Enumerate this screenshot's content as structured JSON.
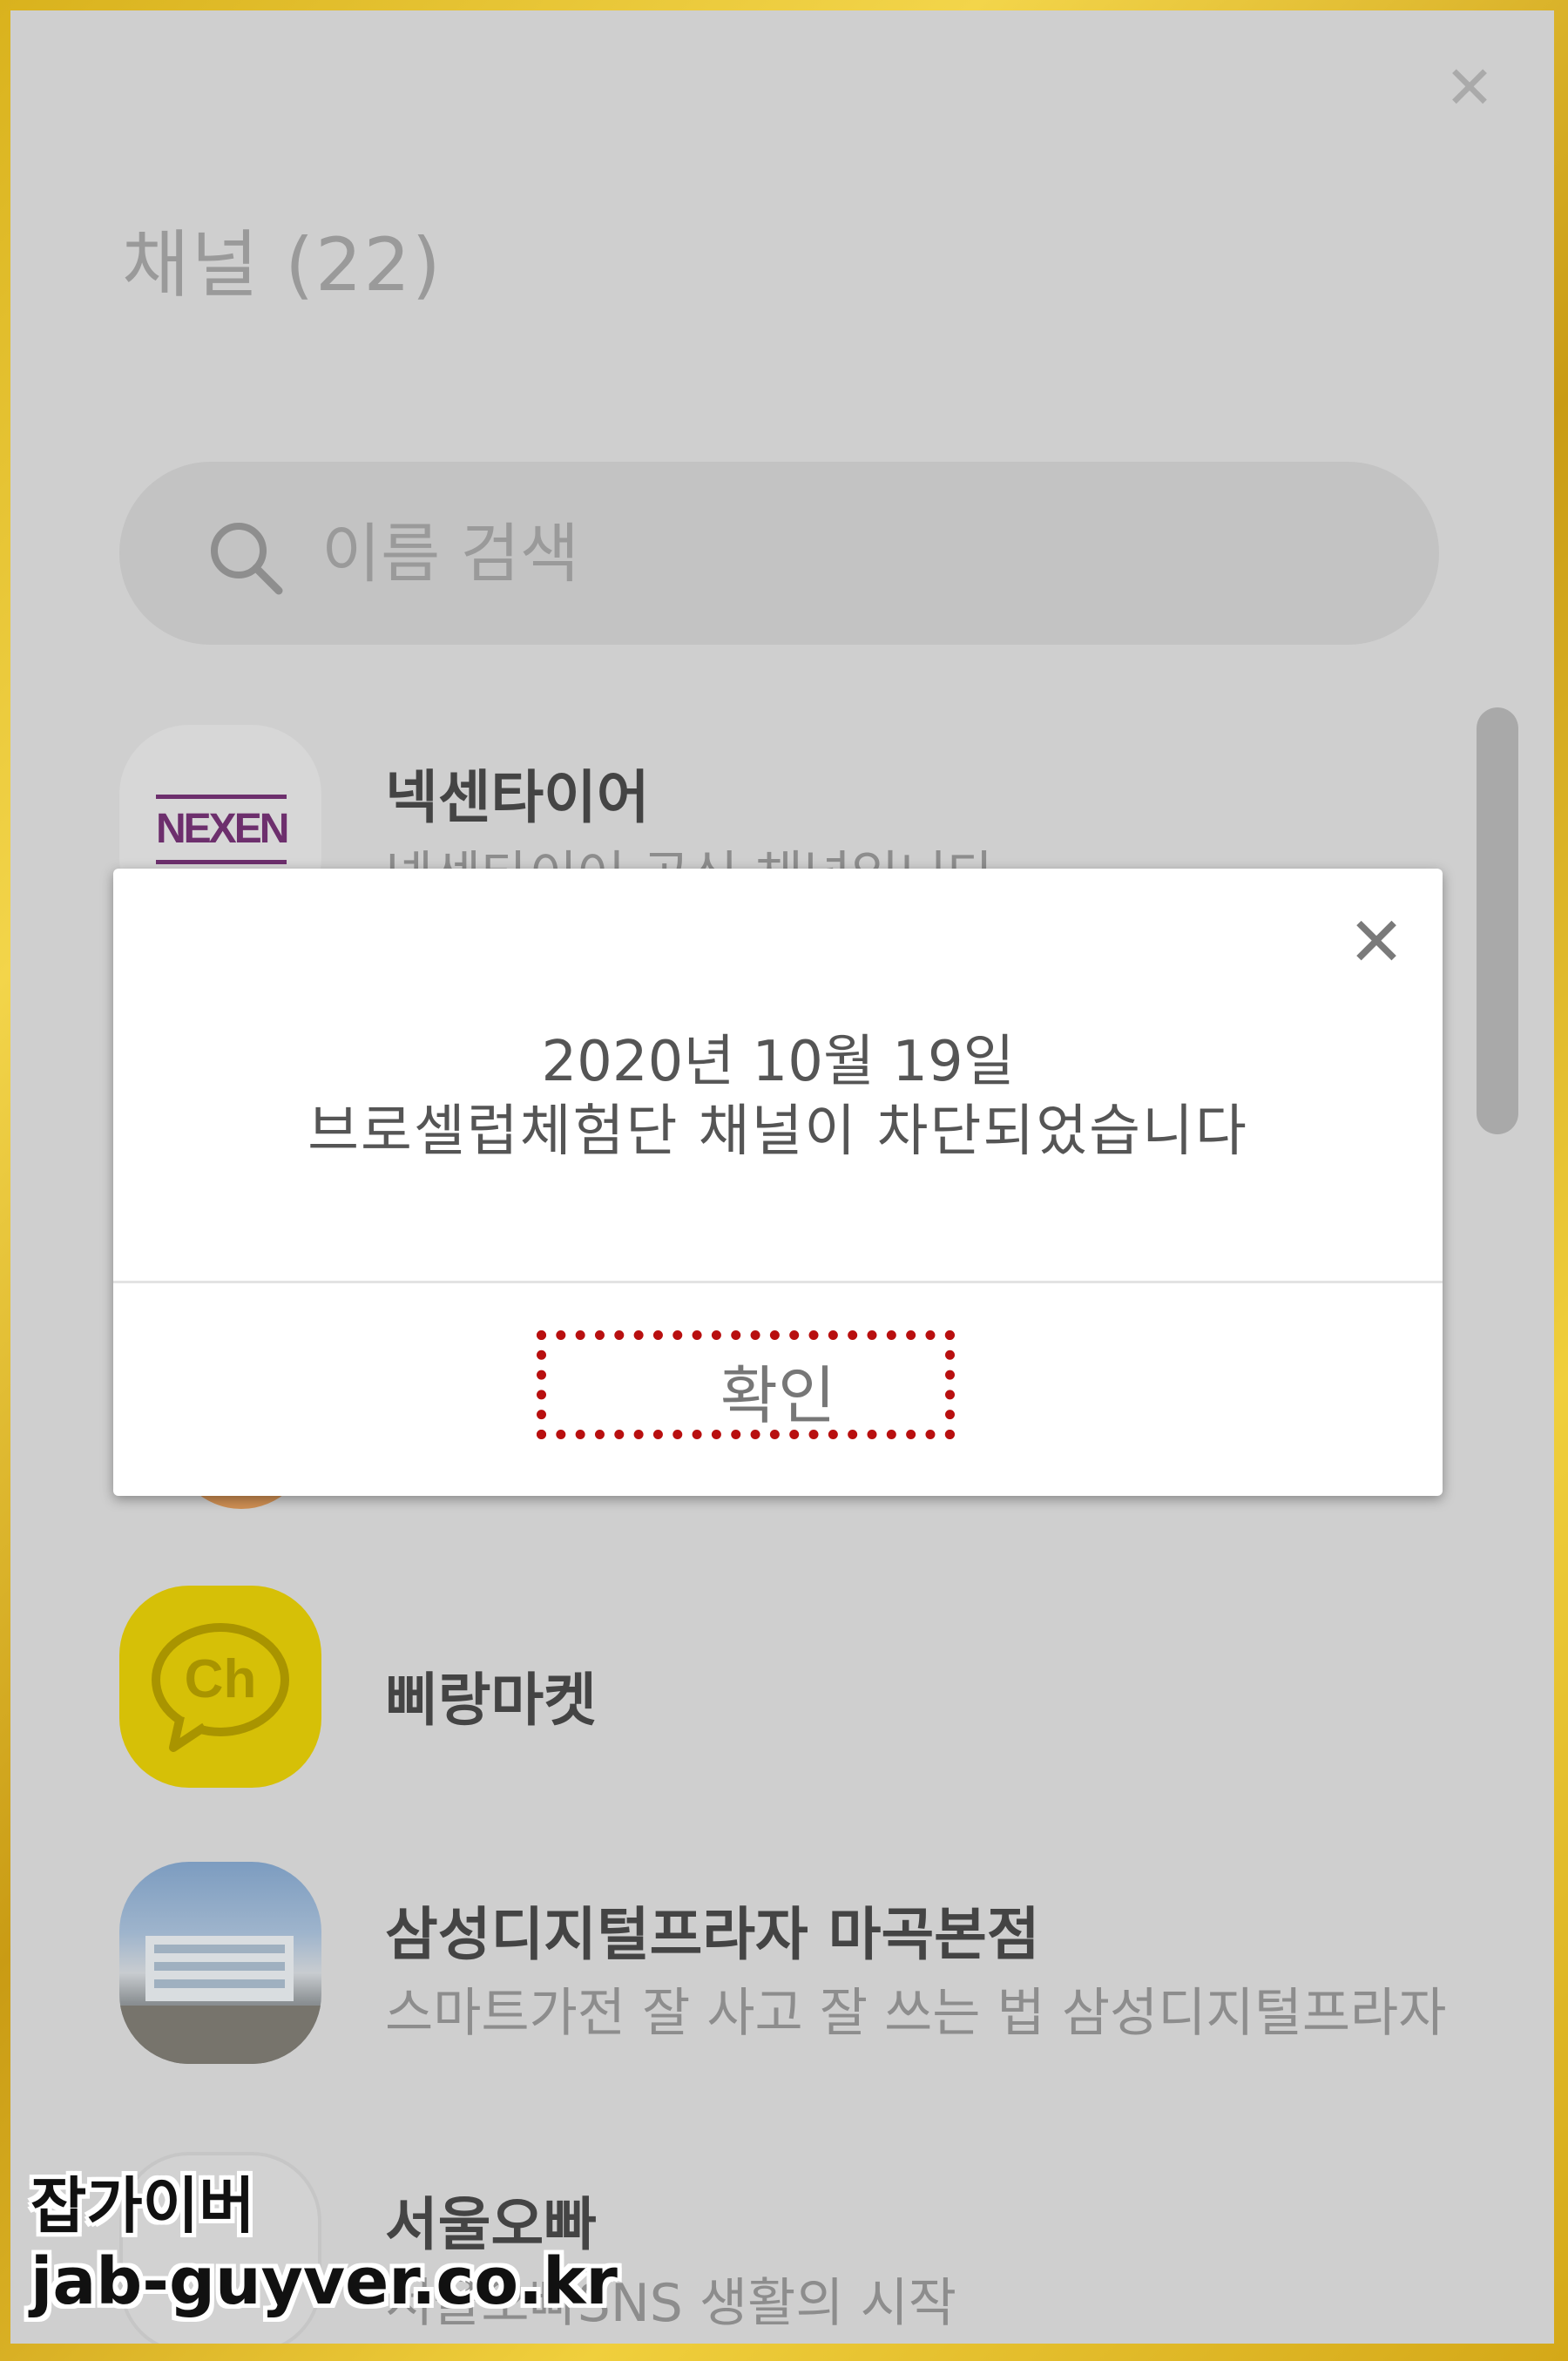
{
  "window": {
    "title": "채널 (22)"
  },
  "search": {
    "placeholder": "이름 검색"
  },
  "channels": [
    {
      "name": "넥센타이어",
      "desc": "넥센타이어 공식 채널입니다",
      "avatar": "NEXEN"
    },
    {
      "name": "삐랑마켓",
      "desc": "",
      "avatar": "Ch"
    },
    {
      "name": "삼성디지털프라자 마곡본점",
      "desc": "스마트가전 잘 사고 잘 쓰는 법 삼성디지털프라자",
      "avatar": "photo"
    },
    {
      "name": "서울오빠",
      "desc": "서울오빠SNS 생활의 시작",
      "avatar": "seoul"
    }
  ],
  "dialog": {
    "date": "2020년 10월 19일",
    "message": "브로셀럽체험단 채널이 차단되었습니다",
    "confirm_label": "확인"
  },
  "watermark": {
    "line1": "잡가이버",
    "line2": "jab-guyver.co.kr"
  },
  "colors": {
    "frame": "#d9b21d",
    "highlight": "#b80f0f",
    "channel_yellow": "#d6c007"
  }
}
